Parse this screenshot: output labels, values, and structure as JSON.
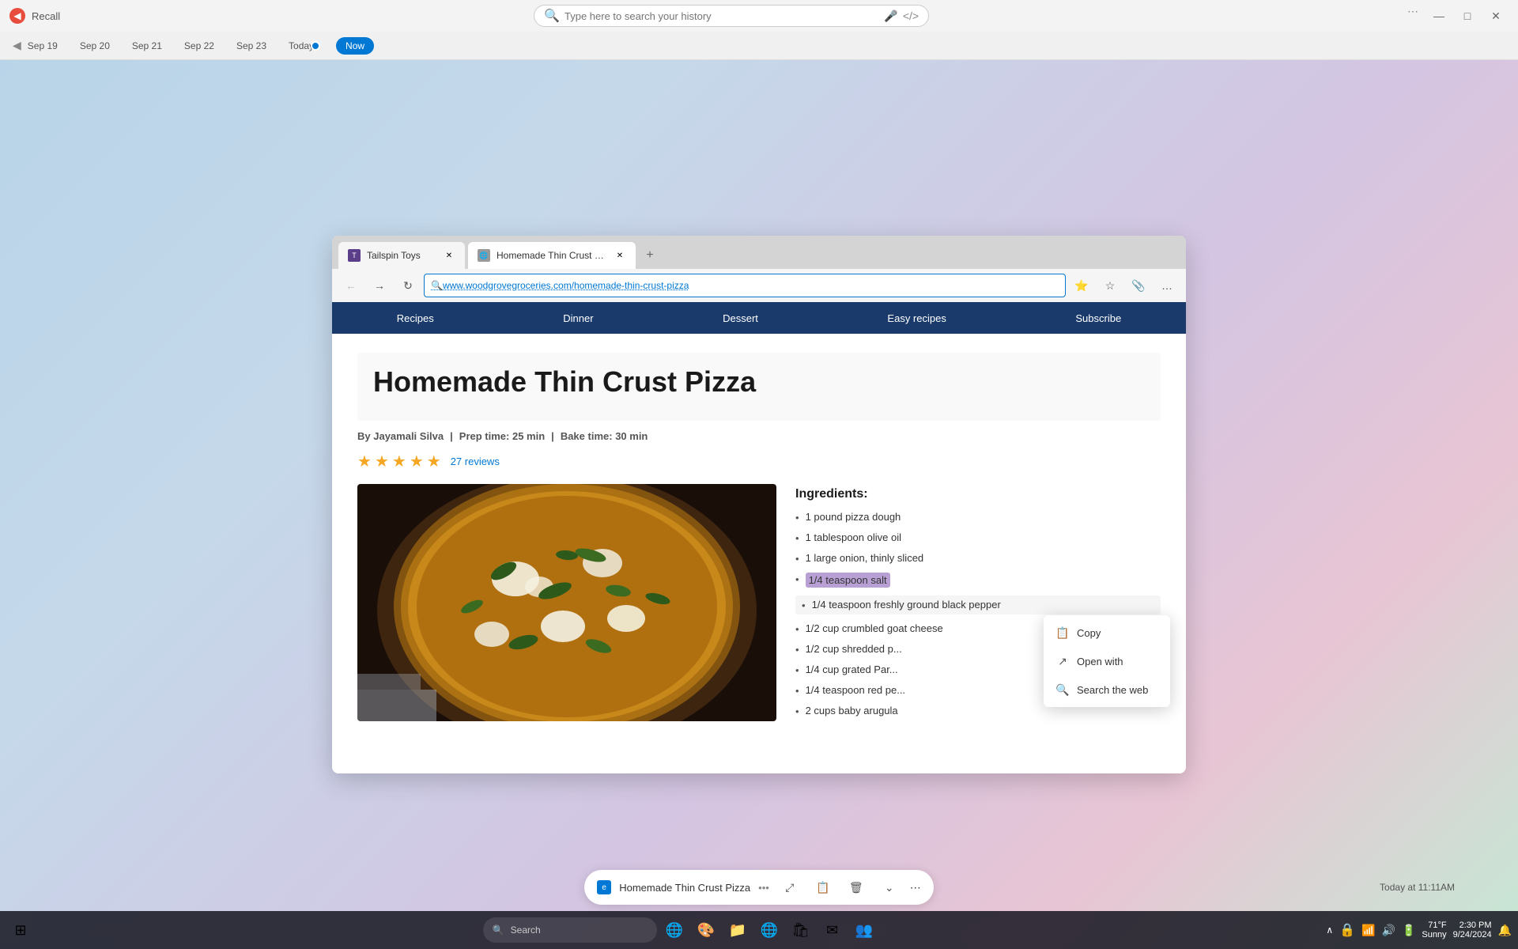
{
  "app": {
    "title": "Recall",
    "icon": "recall-icon"
  },
  "titlebar": {
    "search_placeholder": "Type here to search your history",
    "min_label": "—",
    "max_label": "□",
    "close_label": "✕"
  },
  "timeline": {
    "items": [
      {
        "label": "Sep 19"
      },
      {
        "label": "Sep 20"
      },
      {
        "label": "Sep 21"
      },
      {
        "label": "Sep 22"
      },
      {
        "label": "Sep 23"
      },
      {
        "label": "Today"
      }
    ],
    "now_label": "Now"
  },
  "browser": {
    "tabs": [
      {
        "label": "Tailspin Toys",
        "active": false,
        "favicon": "🏪"
      },
      {
        "label": "Homemade Thin Crust Pizza",
        "active": true,
        "favicon": "🌐"
      }
    ],
    "add_tab_label": "+",
    "nav": {
      "back_label": "←",
      "forward_label": "→",
      "refresh_label": "↻",
      "address": "www.woodgrovegroceries.com/homemade-thin-crust-pizza"
    },
    "nav_icons": {
      "favorites": "☆",
      "reading_view": "☆",
      "collections": "📋",
      "more": "…"
    },
    "site_nav": [
      {
        "label": "Recipes"
      },
      {
        "label": "Dinner"
      },
      {
        "label": "Dessert"
      },
      {
        "label": "Easy recipes"
      },
      {
        "label": "Subscribe"
      }
    ]
  },
  "recipe": {
    "title": "Homemade Thin Crust Pizza",
    "author": "By Jayamali Silva",
    "prep_label": "Prep time",
    "prep_time": "25 min",
    "bake_label": "Bake time",
    "bake_time": "30 min",
    "rating": 4.5,
    "reviews_count": "27 reviews",
    "ingredients_title": "Ingredients:",
    "ingredients": [
      {
        "text": "1 pound pizza dough",
        "highlighted": false
      },
      {
        "text": "1 tablespoon olive oil",
        "highlighted": false
      },
      {
        "text": "1 large onion, thinly sliced",
        "highlighted": false
      },
      {
        "text": "1/4 teaspoon salt",
        "highlighted": true
      },
      {
        "text": "1/4 teaspoon freshly ground black pepper",
        "highlighted": false
      },
      {
        "text": "1/2 cup crumbled goat cheese",
        "highlighted": false
      },
      {
        "text": "1/2 cup shredded p...",
        "highlighted": false
      },
      {
        "text": "1/4 cup grated Par...",
        "highlighted": false
      },
      {
        "text": "1/4 teaspoon red pe...",
        "highlighted": false
      },
      {
        "text": "2 cups baby arugula",
        "highlighted": false
      }
    ]
  },
  "context_menu": {
    "items": [
      {
        "label": "Copy",
        "icon": "📋"
      },
      {
        "label": "Open with",
        "icon": "↗"
      },
      {
        "label": "Search the web",
        "icon": "🔍"
      }
    ]
  },
  "browser_pill": {
    "tab_label": "Homemade Thin Crust Pizza",
    "dots_label": "•••",
    "timestamp": "Today at 11:11AM"
  },
  "taskbar": {
    "start_icon": "⊞",
    "search_placeholder": "Search",
    "weather": {
      "temp": "71°F",
      "condition": "Sunny"
    },
    "clock": {
      "time": "2:30 PM",
      "date": "9/24/2024"
    },
    "apps": [
      {
        "label": "Edge",
        "icon": "🌐"
      },
      {
        "label": "File Explorer",
        "icon": "📁"
      },
      {
        "label": "Color",
        "icon": "🎨"
      },
      {
        "label": "Teams",
        "icon": "👥"
      },
      {
        "label": "Store",
        "icon": "🛍"
      },
      {
        "label": "Mail",
        "icon": "✉"
      }
    ]
  }
}
